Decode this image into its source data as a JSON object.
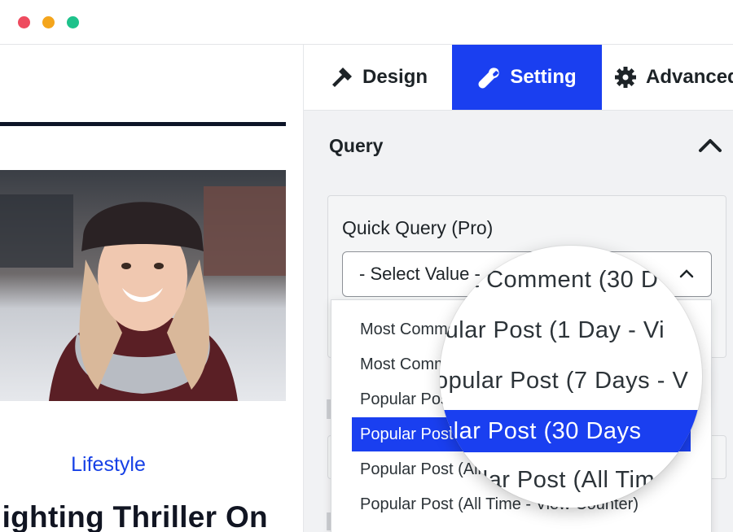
{
  "window": {
    "controls": [
      "close",
      "minimize",
      "maximize"
    ]
  },
  "preview": {
    "category": "Lifestyle",
    "headline": "lighting Thriller On"
  },
  "tabs": [
    {
      "label": "Design",
      "icon": "hammer-icon"
    },
    {
      "label": "Setting",
      "icon": "wrench-icon",
      "active": true
    },
    {
      "label": "Advanced",
      "icon": "gear-icon"
    }
  ],
  "query": {
    "title": "Query",
    "field_label": "Quick Query (Pro)",
    "select_value": "- Select Value -",
    "options": [
      "Most Commented (1 Day - Comment)",
      "Most Commented (30 Days - Comment)",
      "Popular Post (1 Day - View Counter)",
      "Popular Post (30 Days - View Counter)",
      "Popular Post (All Time - View Counter)",
      "Popular Post (All Time - View Counter)"
    ],
    "active_option_index": 3
  },
  "magnifier": {
    "lines": [
      "t Comment (30 D",
      "pular Post (1 Day - Vi",
      "opular Post (7 Days - V",
      "ular Post (30 Days",
      "ular Post (All Time"
    ],
    "active_line_index": 3
  },
  "colors": {
    "accent": "#1a3ff0",
    "category": "#1640e6",
    "dark": "#0d1427"
  }
}
